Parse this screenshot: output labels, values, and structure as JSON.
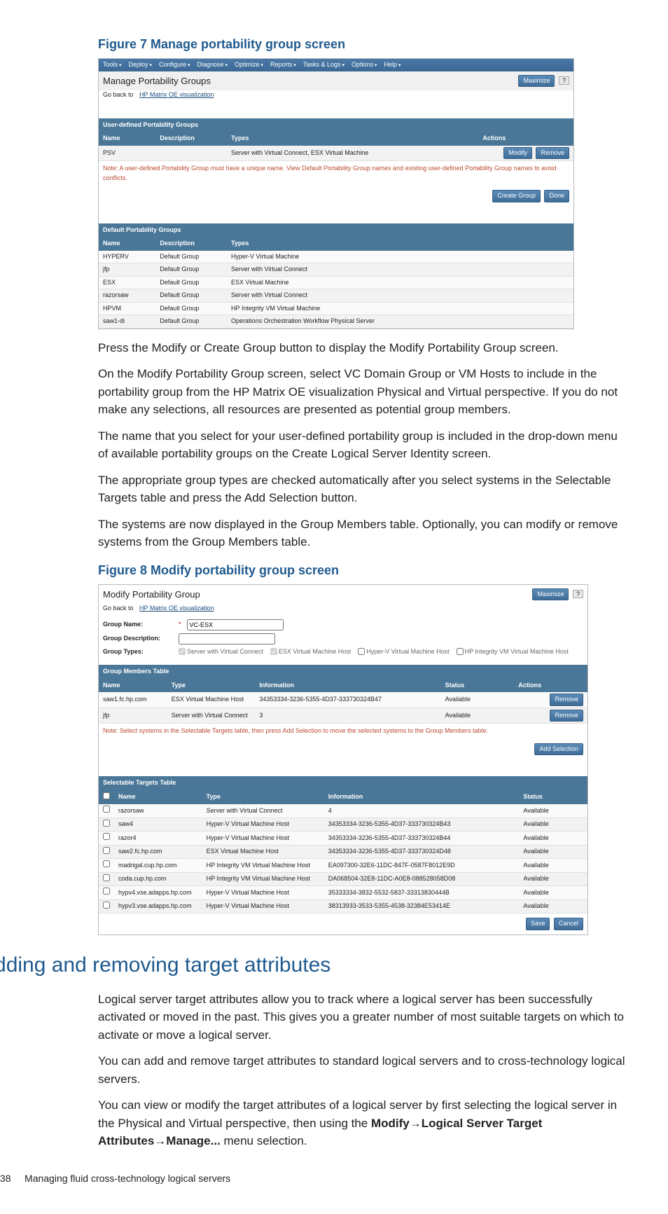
{
  "figure7": {
    "caption": "Figure 7 Manage portability group screen",
    "menubar": [
      "Tools",
      "Deploy",
      "Configure",
      "Diagnose",
      "Optimize",
      "Reports",
      "Tasks & Logs",
      "Options",
      "Help"
    ],
    "title": "Manage Portability Groups",
    "maximize": "Maximize",
    "help_q": "?",
    "go_back_prefix": "Go back to ",
    "go_back_link": "HP Matrix OE visualization",
    "user_defined_header": "User-defined Portability Groups",
    "ud_cols": {
      "name": "Name",
      "desc": "Description",
      "types": "Types",
      "actions": "Actions"
    },
    "ud_row": {
      "name": "PSV",
      "desc": "",
      "types": "Server with Virtual Connect, ESX Virtual Machine",
      "modify": "Modify",
      "remove": "Remove"
    },
    "note_prefix": "Note: ",
    "note_body": "A user-defined Portability Group must have a unique name. View Default Portability Group names and existing user-defined Portability Group names to avoid conflicts.",
    "create_group": "Create Group",
    "done": "Done",
    "default_header": "Default Portability Groups",
    "def_cols": {
      "name": "Name",
      "desc": "Description",
      "types": "Types"
    },
    "def_rows": [
      {
        "name": "HYPERV",
        "desc": "Default Group",
        "types": "Hyper-V Virtual Machine"
      },
      {
        "name": "jfp",
        "desc": "Default Group",
        "types": "Server with Virtual Connect"
      },
      {
        "name": "ESX",
        "desc": "Default Group",
        "types": "ESX Virtual Machine"
      },
      {
        "name": "razorsaw",
        "desc": "Default Group",
        "types": "Server with Virtual Connect"
      },
      {
        "name": "HPVM",
        "desc": "Default Group",
        "types": "HP Integrity VM Virtual Machine"
      },
      {
        "name": "saw1-di",
        "desc": "Default Group",
        "types": "Operations Orchestration Workflow Physical Server"
      }
    ]
  },
  "middle_paragraphs": {
    "p1": "Press the Modify or Create Group button to display the Modify Portability Group screen.",
    "p2": "On the Modify Portability Group screen, select  VC Domain Group or VM Hosts to include in the portability group from the HP Matrix OE visualization Physical and Virtual perspective. If you do not make any selections, all resources are presented as potential group members.",
    "p3": "The name that you select for your user-defined portability group is included in the drop-down menu of available portability groups on the Create Logical Server Identity screen.",
    "p4": "The appropriate group types are checked automatically after you select systems in the Selectable Targets table and press the Add Selection button.",
    "p5": "The systems are now displayed in the Group Members table. Optionally, you can modify or remove systems from the Group Members table."
  },
  "figure8": {
    "caption": "Figure 8 Modify portability group screen",
    "title": "Modify Portability Group",
    "maximize": "Maximize",
    "help_q": "?",
    "go_back_prefix": "Go back to ",
    "go_back_link": "HP Matrix OE visualization",
    "form": {
      "name_label": "Group Name:",
      "name_value": "VC-ESX",
      "desc_label": "Group Description:",
      "desc_value": "",
      "types_label": "Group Types:"
    },
    "type_checks": [
      {
        "label": "Server with Virtual Connect",
        "checked": true
      },
      {
        "label": "ESX Virtual Machine Host",
        "checked": true
      },
      {
        "label": "Hyper-V Virtual Machine Host",
        "checked": false
      },
      {
        "label": "HP Integrity VM Virtual Machine Host",
        "checked": false
      }
    ],
    "members_header": "Group Members Table",
    "members_cols": {
      "name": "Name",
      "type": "Type",
      "info": "Information",
      "status": "Status",
      "actions": "Actions"
    },
    "members_rows": [
      {
        "name": "saw1.fc.hp.com",
        "type": "ESX Virtual Machine Host",
        "info": "34353334-3236-5355-4D37-333730324B47",
        "status": "Available",
        "action": "Remove"
      },
      {
        "name": "jfp",
        "type": "Server with Virtual Connect",
        "info": "3",
        "status": "Available",
        "action": "Remove"
      }
    ],
    "note_prefix": "Note: ",
    "note_body": "Select systems in the Selectable Targets table, then press Add Selection to move the selected systems to the Group Members table.",
    "add_selection": "Add Selection",
    "targets_header": "Selectable Targets Table",
    "targets_cols": {
      "name": "Name",
      "type": "Type",
      "info": "Information",
      "status": "Status"
    },
    "targets_rows": [
      {
        "name": "razorsaw",
        "type": "Server with Virtual Connect",
        "info": "4",
        "status": "Available"
      },
      {
        "name": "saw4",
        "type": "Hyper-V Virtual Machine Host",
        "info": "34353334-3236-5355-4D37-333730324B43",
        "status": "Available"
      },
      {
        "name": "razor4",
        "type": "Hyper-V Virtual Machine Host",
        "info": "34353334-3236-5355-4D37-333730324B44",
        "status": "Available"
      },
      {
        "name": "saw2.fc.hp.com",
        "type": "ESX Virtual Machine Host",
        "info": "34353334-3236-5355-4D37-333730324D48",
        "status": "Available"
      },
      {
        "name": "madrigal.cup.hp.com",
        "type": "HP Integrity VM Virtual Machine Host",
        "info": "EA097300-32E6-11DC-847F-0587F8012E9D",
        "status": "Available"
      },
      {
        "name": "coda.cup.hp.com",
        "type": "HP Integrity VM Virtual Machine Host",
        "info": "DA068504-32E8-11DC-A0E8-088528058D08",
        "status": "Available"
      },
      {
        "name": "hypv4.vse.adapps.hp.com",
        "type": "Hyper-V Virtual Machine Host",
        "info": "35333334-3832-5532-5837-33313830444B",
        "status": "Available"
      },
      {
        "name": "hypv3.vse.adapps.hp.com",
        "type": "Hyper-V Virtual Machine Host",
        "info": "38313933-3533-5355-4538-32384E53414E",
        "status": "Available"
      }
    ],
    "save": "Save",
    "cancel": "Cancel"
  },
  "section": {
    "heading": "Adding and removing target attributes",
    "p1": "Logical server target attributes allow you to track where a logical server has been successfully activated or moved in the past. This gives you a greater number of most suitable targets on which to activate or move a logical server.",
    "p2": "You can add and remove target attributes to standard logical servers and to cross-technology logical servers.",
    "p3_a": "You can view or modify the target attributes of a logical server by first selecting the logical server in the Physical and Virtual perspective, then using the ",
    "p3_b": "Modify",
    "p3_c": "Logical Server Target Attributes",
    "p3_d": "Manage...",
    "p3_e": " menu selection."
  },
  "footer": {
    "page": "38",
    "chapter": "Managing fluid cross-technology logical servers"
  }
}
